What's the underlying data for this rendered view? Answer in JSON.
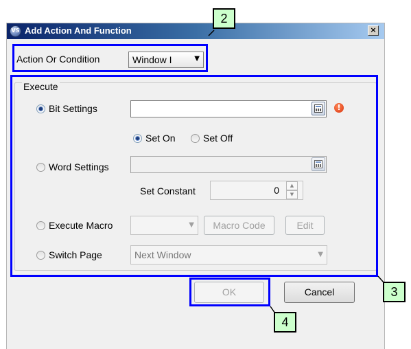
{
  "window": {
    "app_icon_text": "VS",
    "title": "Add Action And Function",
    "close_glyph": "×"
  },
  "action": {
    "label": "Action Or Condition",
    "selected": "Window I",
    "arrow": "▼"
  },
  "execute_group": {
    "title": "Execute",
    "bit_settings": {
      "label": "Bit Settings",
      "checked": true,
      "value": "",
      "warning_glyph": "!"
    },
    "set_on": {
      "label": "Set On",
      "checked": true
    },
    "set_off": {
      "label": "Set Off",
      "checked": false
    },
    "word_settings": {
      "label": "Word Settings",
      "checked": false,
      "value": ""
    },
    "set_constant": {
      "label": "Set Constant",
      "value": "0",
      "up_glyph": "▲",
      "down_glyph": "▼"
    },
    "execute_macro": {
      "label": "Execute Macro",
      "checked": false,
      "selected": "",
      "arrow": "▼",
      "macro_code_label": "Macro Code",
      "edit_label": "Edit"
    },
    "switch_page": {
      "label": "Switch Page",
      "checked": false,
      "selected": "Next Window",
      "arrow": "▼"
    }
  },
  "buttons": {
    "ok_label": "OK",
    "cancel_label": "Cancel"
  },
  "callouts": {
    "c2": "2",
    "c3": "3",
    "c4": "4"
  },
  "colors": {
    "highlight": "#0000ff",
    "callout_bg": "#ccffcc",
    "titlebar_start": "#0a246a",
    "titlebar_end": "#a6caf0",
    "warning": "#d9310b"
  }
}
